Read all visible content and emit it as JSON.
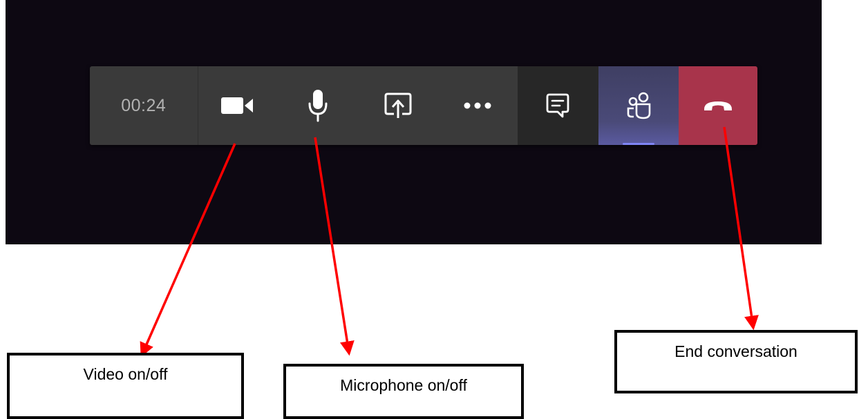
{
  "call_toolbar": {
    "timer": "00:24",
    "buttons": [
      {
        "icon": "video-camera-icon"
      },
      {
        "icon": "microphone-icon"
      },
      {
        "icon": "share-screen-icon"
      },
      {
        "icon": "more-options-icon"
      },
      {
        "icon": "chat-icon"
      },
      {
        "icon": "participants-icon"
      },
      {
        "icon": "hang-up-icon"
      }
    ],
    "colors": {
      "toolbar_bg": "#3a3a3a",
      "chat_bg": "#272727",
      "participants_bg": "#4a4a78",
      "end_bg": "#a8344b",
      "screen_bg": "#0d0812",
      "arrow": "#ff0000"
    }
  },
  "annotations": {
    "video": "Video on/off",
    "microphone": "Microphone on/off",
    "end": "End conversation"
  }
}
